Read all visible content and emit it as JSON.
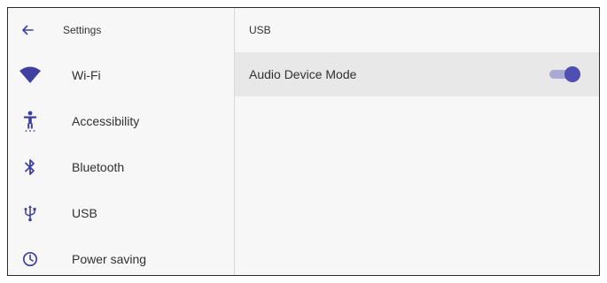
{
  "sidebar": {
    "header": {
      "back_icon": "arrow-left-icon",
      "title": "Settings"
    },
    "items": [
      {
        "label": "Wi-Fi",
        "icon": "wifi-icon"
      },
      {
        "label": "Accessibility",
        "icon": "accessibility-icon"
      },
      {
        "label": "Bluetooth",
        "icon": "bluetooth-icon"
      },
      {
        "label": "USB",
        "icon": "usb-icon"
      },
      {
        "label": "Power saving",
        "icon": "clock-icon"
      }
    ]
  },
  "main": {
    "title": "USB",
    "settings": [
      {
        "label": "Audio Device Mode",
        "enabled": true
      }
    ]
  },
  "colors": {
    "accent": "#4f4fb2",
    "accent_track": "#a9a9d6",
    "icon": "#3f3fa0",
    "background": "#f7f7f7",
    "row_highlight": "#e8e8e8"
  }
}
